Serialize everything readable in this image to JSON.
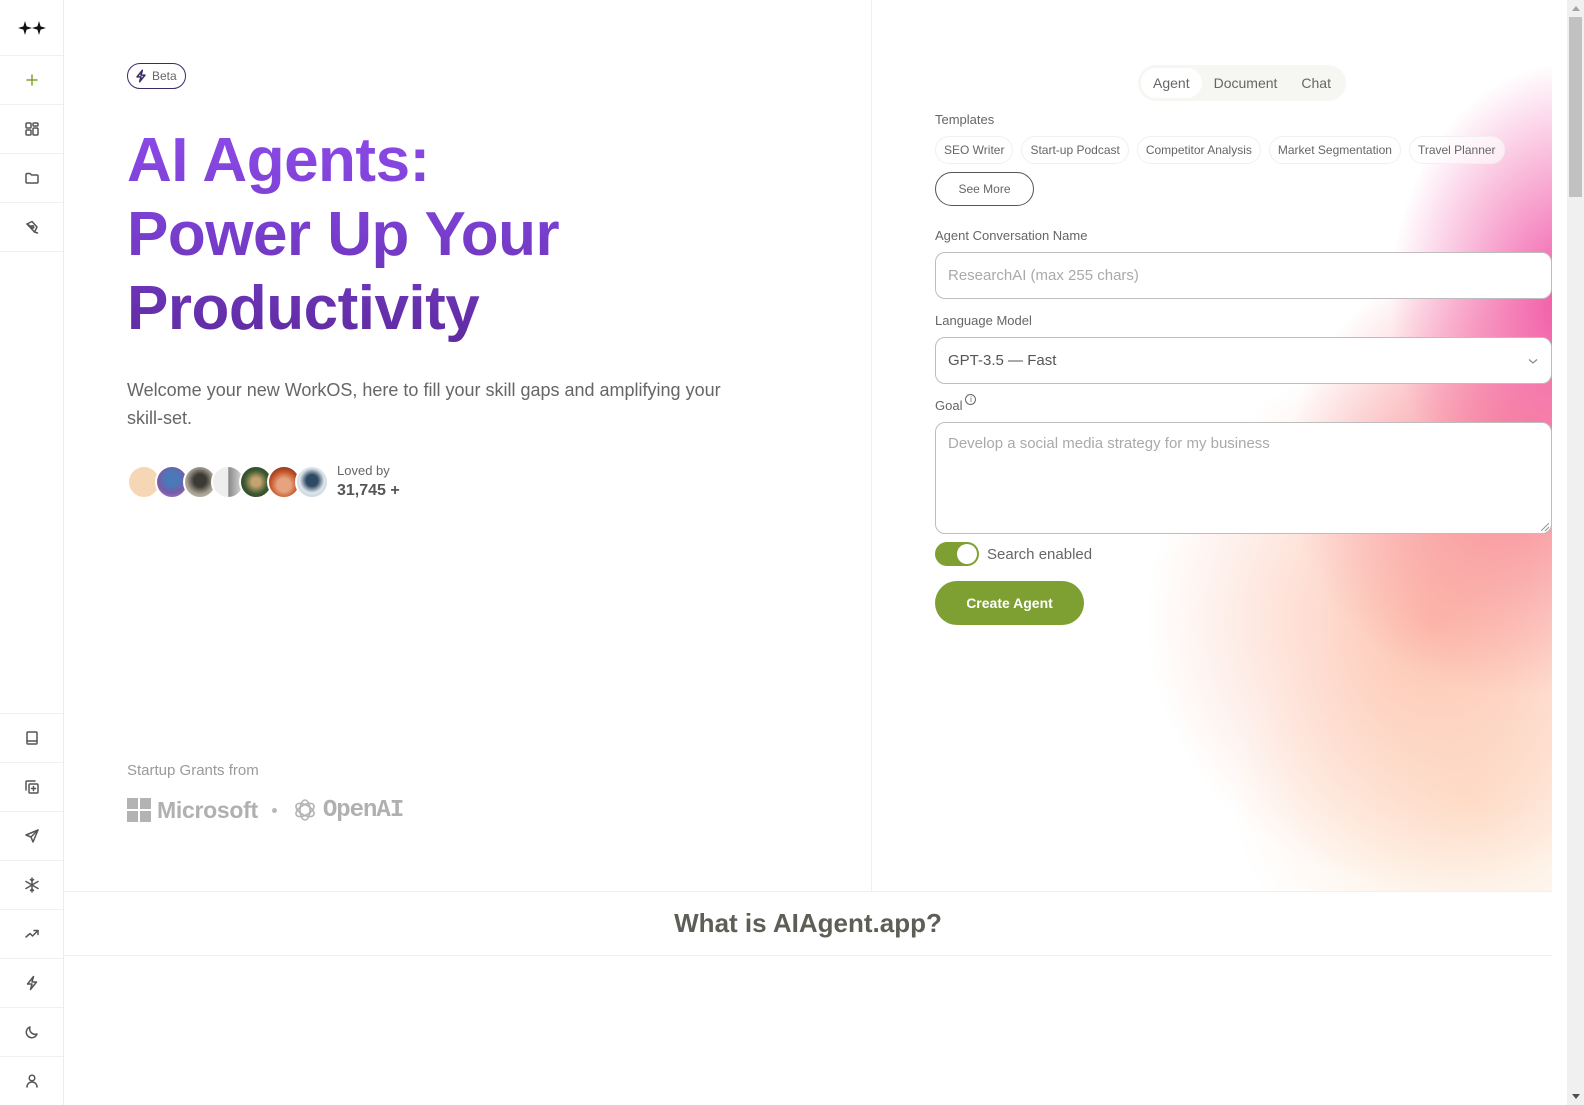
{
  "sidebar": {
    "top_items": [
      {
        "name": "logo",
        "icon": "sparkles-icon"
      },
      {
        "name": "new",
        "icon": "plus-icon"
      },
      {
        "name": "dashboard",
        "icon": "dashboard-icon"
      },
      {
        "name": "folders",
        "icon": "folder-icon"
      },
      {
        "name": "design",
        "icon": "pen-tool-icon"
      }
    ],
    "bottom_items": [
      {
        "name": "library",
        "icon": "book-icon"
      },
      {
        "name": "duplicate",
        "icon": "copy-plus-icon"
      },
      {
        "name": "send",
        "icon": "send-icon"
      },
      {
        "name": "integrations",
        "icon": "snowflake-icon"
      },
      {
        "name": "trending",
        "icon": "trending-up-icon"
      },
      {
        "name": "upgrade",
        "icon": "lightning-icon"
      },
      {
        "name": "theme",
        "icon": "moon-icon"
      },
      {
        "name": "profile",
        "icon": "user-icon"
      }
    ]
  },
  "hero": {
    "badge": "Beta",
    "title_lines": [
      "AI Agents:",
      "Power Up Your",
      "Productivity"
    ],
    "subtitle": "Welcome your new WorkOS, here to fill your skill gaps and amplifying your skill-set.",
    "loved_label": "Loved by",
    "loved_count": "31,745 +",
    "avatar_count": 7
  },
  "grants": {
    "label": "Startup Grants from",
    "partners": [
      "Microsoft",
      "OpenAI"
    ]
  },
  "mode_tabs": {
    "items": [
      "Agent",
      "Document",
      "Chat"
    ],
    "active": "Agent"
  },
  "form": {
    "templates_label": "Templates",
    "templates": [
      "SEO Writer",
      "Start-up Podcast",
      "Competitor Analysis",
      "Market Segmentation",
      "Travel Planner"
    ],
    "see_more": "See More",
    "name_label": "Agent Conversation Name",
    "name_placeholder": "ResearchAI (max 255 chars)",
    "model_label": "Language Model",
    "model_value": "GPT-3.5 — Fast",
    "goal_label": "Goal",
    "goal_placeholder": "Develop a social media strategy for my business",
    "search_label": "Search enabled",
    "search_enabled": true,
    "create_button": "Create Agent"
  },
  "section": {
    "what_title": "What is AIAgent.app?"
  },
  "colors": {
    "accent_green": "#7e9f31",
    "title_purple": "#7a3fd0",
    "badge_outline": "#3b2a66"
  }
}
